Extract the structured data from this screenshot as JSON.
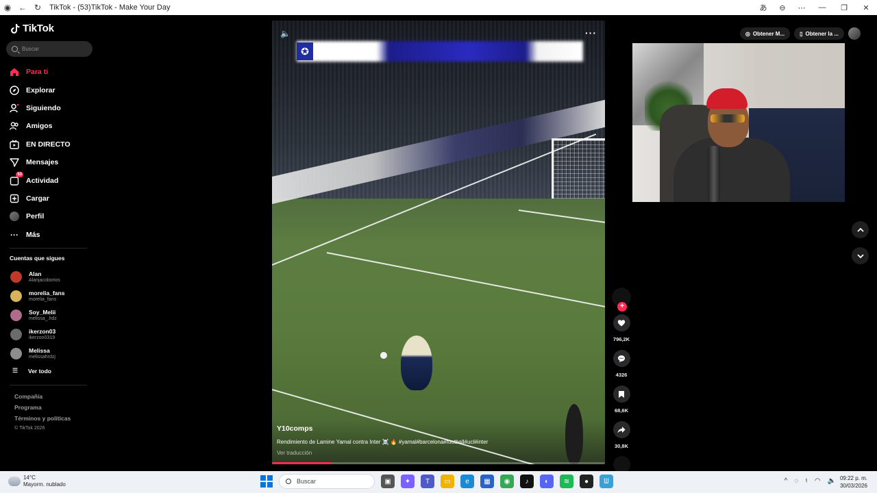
{
  "browser": {
    "title": "TikTok - (53)TikTok - Make Your Day"
  },
  "sidebar": {
    "logo": "TikTok",
    "search_placeholder": "Buscar",
    "nav": [
      {
        "label": "Para ti",
        "icon": "home-icon",
        "active": true
      },
      {
        "label": "Explorar",
        "icon": "compass-icon"
      },
      {
        "label": "Siguiendo",
        "icon": "following-icon"
      },
      {
        "label": "Amigos",
        "icon": "friends-icon"
      },
      {
        "label": "EN DIRECTO",
        "icon": "live-icon"
      },
      {
        "label": "Mensajes",
        "icon": "messages-icon"
      },
      {
        "label": "Actividad",
        "icon": "activity-icon",
        "badge": "53"
      },
      {
        "label": "Cargar",
        "icon": "upload-icon"
      },
      {
        "label": "Perfil",
        "icon": "profile-avatar"
      },
      {
        "label": "Más",
        "icon": "more-icon"
      }
    ],
    "following_title": "Cuentas que sigues",
    "following": [
      {
        "name": "Alan",
        "user": "Alanjacoborios",
        "color": "#c0392b"
      },
      {
        "name": "morelia_fans",
        "user": "morelia_fans",
        "color": "#d8b35a"
      },
      {
        "name": "Soy_Melii",
        "user": "melissa_.hdz",
        "color": "#b06a8a"
      },
      {
        "name": "ikerzon03",
        "user": "ikerzon0319",
        "color": "#6b6b6b"
      },
      {
        "name": "Melissa",
        "user": "melissahrdzj",
        "color": "#8d8d8d"
      }
    ],
    "see_all": "Ver todo",
    "footer": [
      "Compañía",
      "Programa",
      "Términos y políticas"
    ],
    "copyright": "© TikTok 2026"
  },
  "video": {
    "author": "Y10comps",
    "description": "Rendimiento de Lamine Yamal contra Inter ☠️ 🔥 #yamal#barcelona#football#ucl#inter",
    "translate": "Ver traducción",
    "progress": 0.18
  },
  "actions": {
    "likes": "796,2K",
    "comments": "4326",
    "saves": "68,6K",
    "shares": "30,8K"
  },
  "topbar": {
    "get_app": "Obtener M...",
    "get_app2": "Obtener la ..."
  },
  "taskbar": {
    "temp": "14°C",
    "weather": "Mayorm. nublado",
    "search": "Buscar",
    "time": "09:22 p. m.",
    "date": "30/03/2026"
  },
  "colors": {
    "accent": "#fe2c55"
  }
}
